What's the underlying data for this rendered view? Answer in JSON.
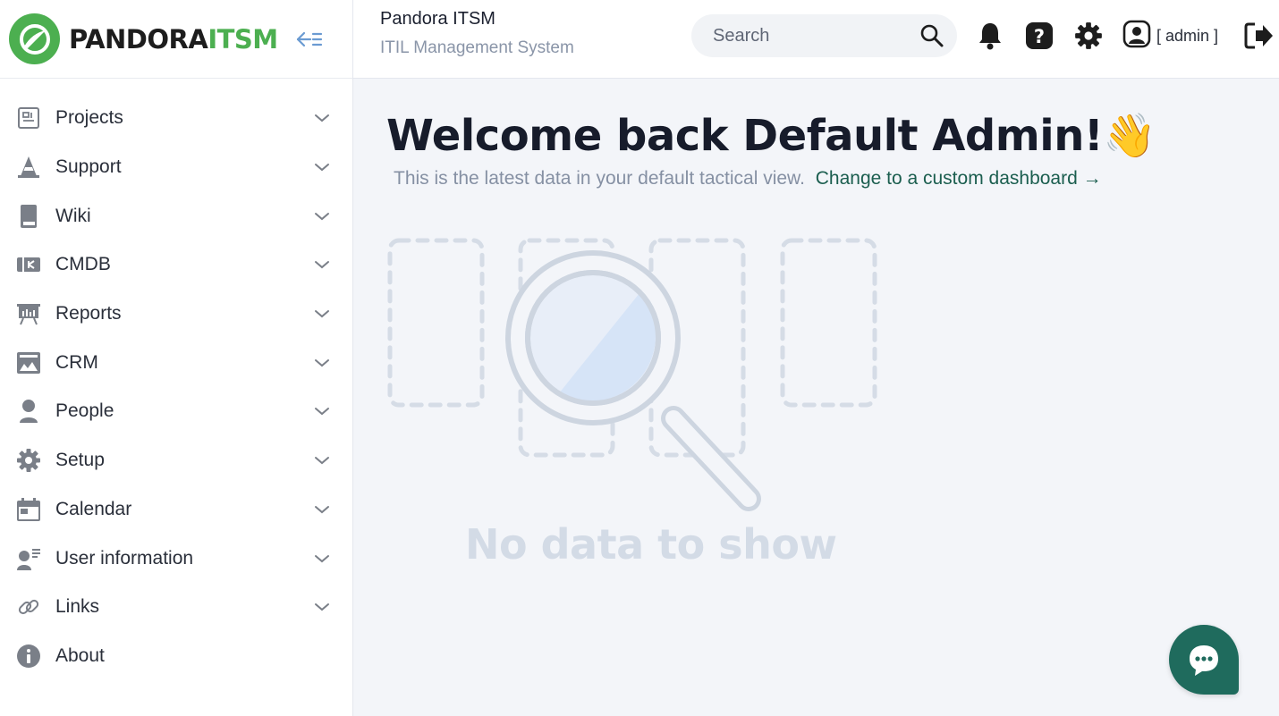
{
  "brand": {
    "name_part1": "PANDORA",
    "name_part2": "ITSM",
    "accent": "#4caf50"
  },
  "header": {
    "title": "Pandora ITSM",
    "subtitle": "ITIL Management System",
    "search_placeholder": "Search",
    "user_label": "[ admin ]"
  },
  "sidebar": {
    "items": [
      {
        "label": "Projects",
        "icon": "projects-icon"
      },
      {
        "label": "Support",
        "icon": "support-cone-icon"
      },
      {
        "label": "Wiki",
        "icon": "book-icon"
      },
      {
        "label": "CMDB",
        "icon": "cmdb-icon"
      },
      {
        "label": "Reports",
        "icon": "presentation-icon"
      },
      {
        "label": "CRM",
        "icon": "crm-icon"
      },
      {
        "label": "People",
        "icon": "person-icon"
      },
      {
        "label": "Setup",
        "icon": "gear-icon"
      },
      {
        "label": "Calendar",
        "icon": "calendar-icon"
      },
      {
        "label": "User information",
        "icon": "user-info-icon"
      },
      {
        "label": "Links",
        "icon": "link-icon"
      },
      {
        "label": "About",
        "icon": "info-icon"
      }
    ]
  },
  "main": {
    "welcome": "Welcome back Default Admin!👋",
    "subtitle": "This is the latest data in your default tactical view.",
    "custom_link": "Change to a custom dashboard →",
    "empty_text": "No data to show"
  },
  "colors": {
    "link": "#1b5e4f",
    "chat": "#1f6b5d",
    "icon_gray": "#7a7f88"
  }
}
